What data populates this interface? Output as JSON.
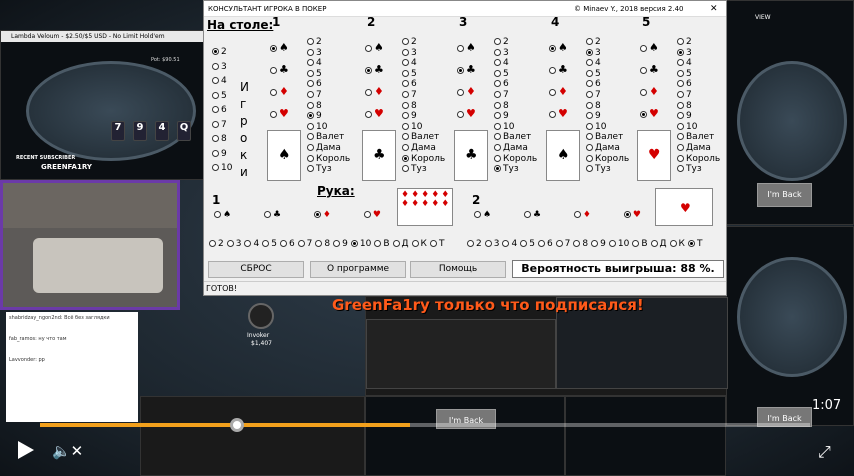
{
  "app": {
    "title": "КОНСУЛЬТАНТ ИГРОКА В ПОКЕР",
    "copyright": "© Minaev Y., 2018 версия 2.40",
    "close": "✕"
  },
  "table": {
    "header": "На столе:",
    "players_label": "И г р о к и",
    "player_counts": [
      "2",
      "3",
      "4",
      "5",
      "6",
      "7",
      "8",
      "9",
      "10"
    ],
    "selected_count": "2"
  },
  "columns": [
    {
      "num": "1",
      "ranks": [
        "2",
        "3",
        "4",
        "5",
        "6",
        "7",
        "8",
        "9",
        "10",
        "Валет",
        "Дама",
        "Король",
        "Туз"
      ],
      "selected_rank": "9",
      "suit": "♠"
    },
    {
      "num": "2",
      "ranks": [
        "2",
        "3",
        "4",
        "5",
        "6",
        "7",
        "8",
        "9",
        "10",
        "Валет",
        "Дама",
        "Король",
        "Туз"
      ],
      "selected_rank": "Король",
      "suit": "♣"
    },
    {
      "num": "3",
      "ranks": [
        "2",
        "3",
        "4",
        "5",
        "6",
        "7",
        "8",
        "9",
        "10",
        "Валет",
        "Дама",
        "Король",
        "Туз"
      ],
      "selected_rank": "Туз",
      "suit": "♣"
    },
    {
      "num": "4",
      "ranks": [
        "2",
        "3",
        "4",
        "5",
        "6",
        "7",
        "8",
        "9",
        "10",
        "Валет",
        "Дама",
        "Король",
        "Туз"
      ],
      "selected_rank": "3",
      "suit": "♠"
    },
    {
      "num": "5",
      "ranks": [
        "2",
        "3",
        "4",
        "5",
        "6",
        "7",
        "8",
        "9",
        "10",
        "Валет",
        "Дама",
        "Король",
        "Туз"
      ],
      "selected_rank": "3",
      "suit": "♥"
    }
  ],
  "hand": {
    "header": "Рука:",
    "card1": {
      "num": "1",
      "ranks_row": [
        "2",
        "3",
        "4",
        "5",
        "6",
        "7",
        "8",
        "9",
        "10",
        "В",
        "Д",
        "К",
        "Т"
      ],
      "selected": "10"
    },
    "card2": {
      "num": "2",
      "ranks_row": [
        "2",
        "3",
        "4",
        "5",
        "6",
        "7",
        "8",
        "9",
        "10",
        "В",
        "Д",
        "К",
        "Т"
      ],
      "selected": "Т"
    }
  },
  "buttons": {
    "reset": "СБРОС",
    "about": "О программе",
    "help": "Помощь"
  },
  "probability": "Вероятность выигрыша: 88 %.",
  "status": "ГОТОВ!",
  "stream": {
    "subscriber_label": "RECENT SUBSCRIBER",
    "subscriber_name": "GREENFA1RY",
    "overlay": "GreenFa1ry только что подписался!",
    "time": "1:07",
    "player_name": "Invoker",
    "player_stack": "$1,407",
    "im_back": "I'm Back",
    "view": "VIEW",
    "pot": "Pot: $90.51",
    "hand_title": "Lambda Veloum - $2.50/$5 USD - No Limit Hold'em",
    "chat_line1": "shabridzay_ngon2nd: Всё без заглядки",
    "chat_line2": "fab_ramos: ну что там",
    "chat_line3": "Lavvonder: pp"
  },
  "colors": {
    "accent": "#ff5a1a",
    "probability_bg": "#ffffff"
  }
}
